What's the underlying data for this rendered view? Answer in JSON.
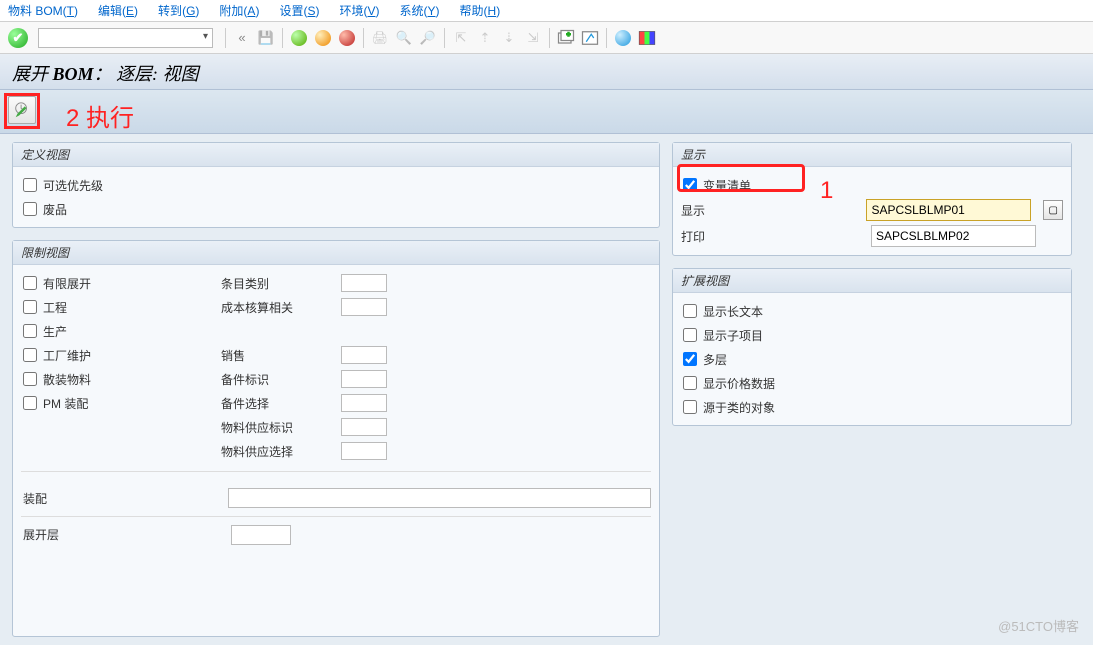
{
  "menu": {
    "items": [
      {
        "label": "物料 BOM",
        "key": "T"
      },
      {
        "label": "编辑",
        "key": "E"
      },
      {
        "label": "转到",
        "key": "G"
      },
      {
        "label": "附加",
        "key": "A"
      },
      {
        "label": "设置",
        "key": "S"
      },
      {
        "label": "环境",
        "key": "V"
      },
      {
        "label": "系统",
        "key": "Y"
      },
      {
        "label": "帮助",
        "key": "H"
      }
    ]
  },
  "title": {
    "pre": "展开 ",
    "bold": "BOM",
    "post": "： 逐层: 视图"
  },
  "annotations": {
    "exec": "2 执行",
    "one": "1"
  },
  "panels": {
    "define": {
      "title": "定义视图",
      "items": [
        "可选优先级",
        "废品"
      ]
    },
    "restrict": {
      "title": "限制视图",
      "left": [
        "有限展开",
        "工程",
        "生产",
        "工厂维护",
        "散装物料",
        "PM 装配"
      ],
      "right": [
        {
          "label": "条目类别",
          "input": true
        },
        {
          "label": "成本核算相关",
          "input": true
        },
        {
          "label": "",
          "input": false
        },
        {
          "label": "销售",
          "input": true
        },
        {
          "label": "备件标识",
          "input": true
        },
        {
          "label": "备件选择",
          "input": true
        },
        {
          "label": "物料供应标识",
          "input": true
        },
        {
          "label": "物料供应选择",
          "input": true
        }
      ]
    },
    "display": {
      "title": "显示",
      "chk": "变量清单",
      "rows": [
        {
          "label": "显示",
          "value": "SAPCSLBLMP01",
          "highlight": true,
          "f4": true
        },
        {
          "label": "打印",
          "value": "SAPCSLBLMP02",
          "highlight": false,
          "f4": false
        }
      ]
    },
    "extend": {
      "title": "扩展视图",
      "items": [
        {
          "label": "显示长文本",
          "checked": false
        },
        {
          "label": "显示子项目",
          "checked": false
        },
        {
          "label": "多层",
          "checked": true
        },
        {
          "label": "显示价格数据",
          "checked": false
        },
        {
          "label": "源于类的对象",
          "checked": false
        }
      ]
    }
  },
  "bottom": {
    "assembly": "装配",
    "level": "展开层"
  },
  "watermark": "@51CTO博客"
}
